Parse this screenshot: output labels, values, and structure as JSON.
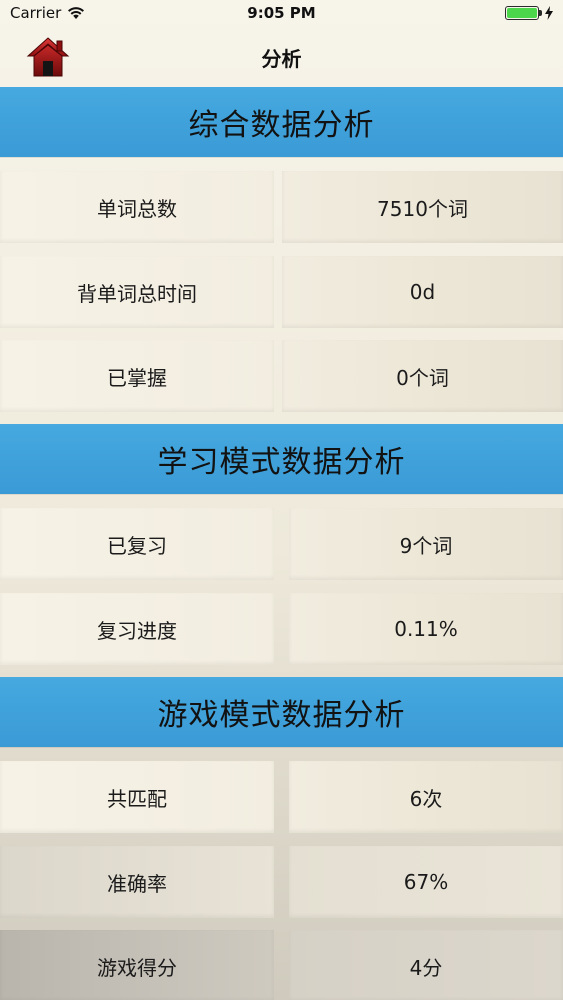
{
  "status_bar": {
    "carrier": "Carrier",
    "time": "9:05 PM",
    "battery_color": "#4bd64b"
  },
  "nav": {
    "title": "分析",
    "home_icon": "home-icon"
  },
  "sections": [
    {
      "title": "综合数据分析",
      "rows": [
        {
          "label": "单词总数",
          "value": "7510个词"
        },
        {
          "label": "背单词总时间",
          "value": "0d"
        },
        {
          "label": "已掌握",
          "value": "0个词"
        }
      ]
    },
    {
      "title": "学习模式数据分析",
      "rows": [
        {
          "label": "已复习",
          "value": "9个词"
        },
        {
          "label": "复习进度",
          "value": "0.11%"
        }
      ]
    },
    {
      "title": "游戏模式数据分析",
      "rows": [
        {
          "label": "共匹配",
          "value": "6次"
        },
        {
          "label": "准确率",
          "value": "67%"
        },
        {
          "label": "游戏得分",
          "value": "4分"
        }
      ]
    }
  ],
  "colors": {
    "section_header": "#43a6dd",
    "cell_background": "#f4f0e4"
  }
}
